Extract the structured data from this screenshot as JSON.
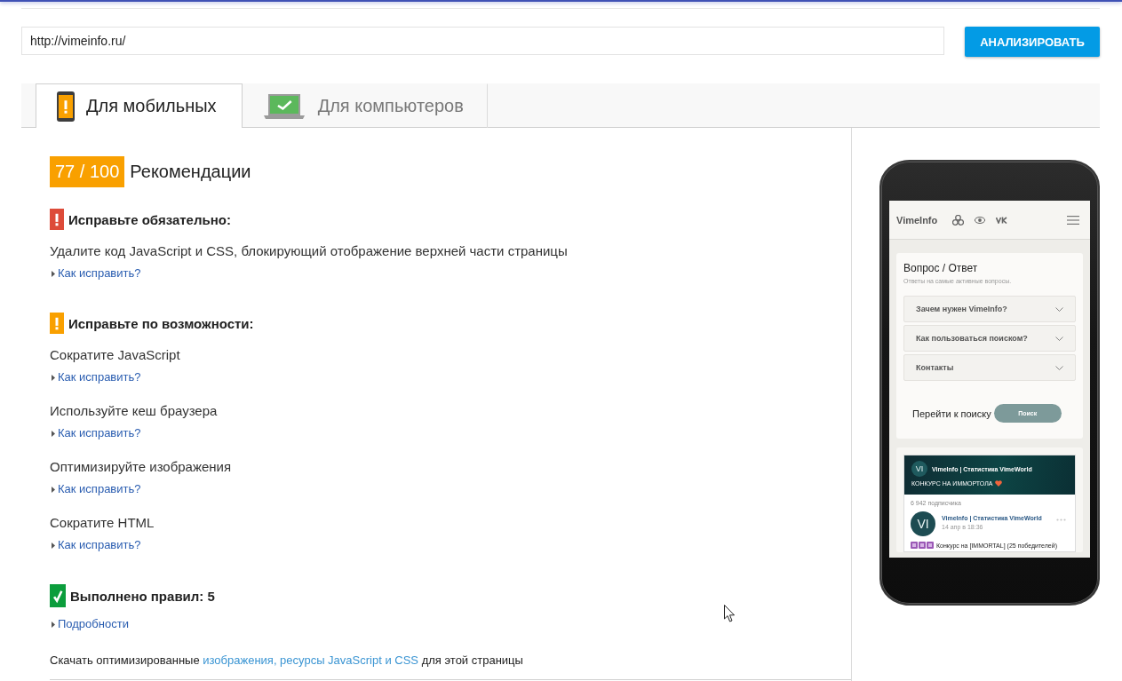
{
  "url_field": {
    "value": "http://vimeinfo.ru/"
  },
  "analyze_button": {
    "label": "АНАЛИЗИРОВАТЬ"
  },
  "tabs": [
    {
      "label": "Для мобильных",
      "kind": "mobile",
      "warning": true,
      "selected": true
    },
    {
      "label": "Для компьютеров",
      "kind": "desktop",
      "warning": false,
      "selected": false
    }
  ],
  "score": {
    "value": "77 / 100",
    "title": "Рекомендации"
  },
  "sections": [
    {
      "kind": "must_fix",
      "title": "Исправьте обязательно:",
      "rules": [
        {
          "name": "Удалите код JavaScript и CSS, блокирующий отображение верхней части страницы",
          "link": "Как исправить?"
        }
      ]
    },
    {
      "kind": "should_fix",
      "title": "Исправьте по возможности:",
      "rules": [
        {
          "name": "Сократите JavaScript",
          "link": "Как исправить?"
        },
        {
          "name": "Используйте кеш браузера",
          "link": "Как исправить?"
        },
        {
          "name": "Оптимизируйте изображения",
          "link": "Как исправить?"
        },
        {
          "name": "Сократите HTML",
          "link": "Как исправить?"
        }
      ]
    },
    {
      "kind": "passed",
      "title": "Выполнено правил: 5",
      "link": "Подробности"
    }
  ],
  "download_note": {
    "text_before": "Скачать оптимизированные",
    "link": "изображения, ресурсы JavaScript и CSS",
    "text_after": "для этой страницы"
  },
  "preview": {
    "site_name": "VimeInfo",
    "faq": {
      "title": "Вопрос / Ответ",
      "subtitle": "Ответы на самые активные вопросы.",
      "items": [
        "Зачем нужен VimeInfo?",
        "Как пользоваться поиском?",
        "Контакты"
      ]
    },
    "search": {
      "prompt": "Перейти к поиску",
      "button": "Поиск"
    },
    "widget": {
      "cover": {
        "avatar": "VI",
        "name": "VimeInfo | Статистика VimeWorld",
        "caption": "КОНКУРС НА ИММОРТОЛА"
      },
      "subscribers": "6 942 подписчика",
      "post": {
        "avatar": "VI",
        "author": "VimeInfo | Статистика VimeWorld",
        "time": "14 апр в 18:36",
        "text": "Конкурс на [IMMORTAL] (25 победителей)"
      }
    }
  }
}
